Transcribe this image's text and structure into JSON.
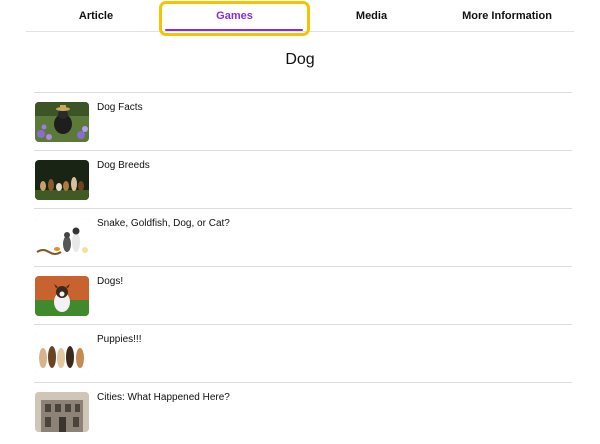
{
  "tabs": {
    "article": "Article",
    "games": "Games",
    "media": "Media",
    "more": "More Information"
  },
  "colors": {
    "accent": "#8a2be2",
    "highlight": "#f5c400",
    "divider": "#dcdcdc"
  },
  "page": {
    "title": "Dog"
  },
  "items": [
    {
      "label": "Dog Facts",
      "icon": "dog-in-flowers-thumbnail"
    },
    {
      "label": "Dog Breeds",
      "icon": "dogs-group-dark-thumbnail"
    },
    {
      "label": "Snake, Goldfish, Dog, or Cat?",
      "icon": "pets-lineup-thumbnail"
    },
    {
      "label": "Dogs!",
      "icon": "dog-on-grass-thumbnail"
    },
    {
      "label": "Puppies!!!",
      "icon": "puppies-row-thumbnail"
    },
    {
      "label": "Cities: What Happened Here?",
      "icon": "old-building-thumbnail"
    }
  ]
}
